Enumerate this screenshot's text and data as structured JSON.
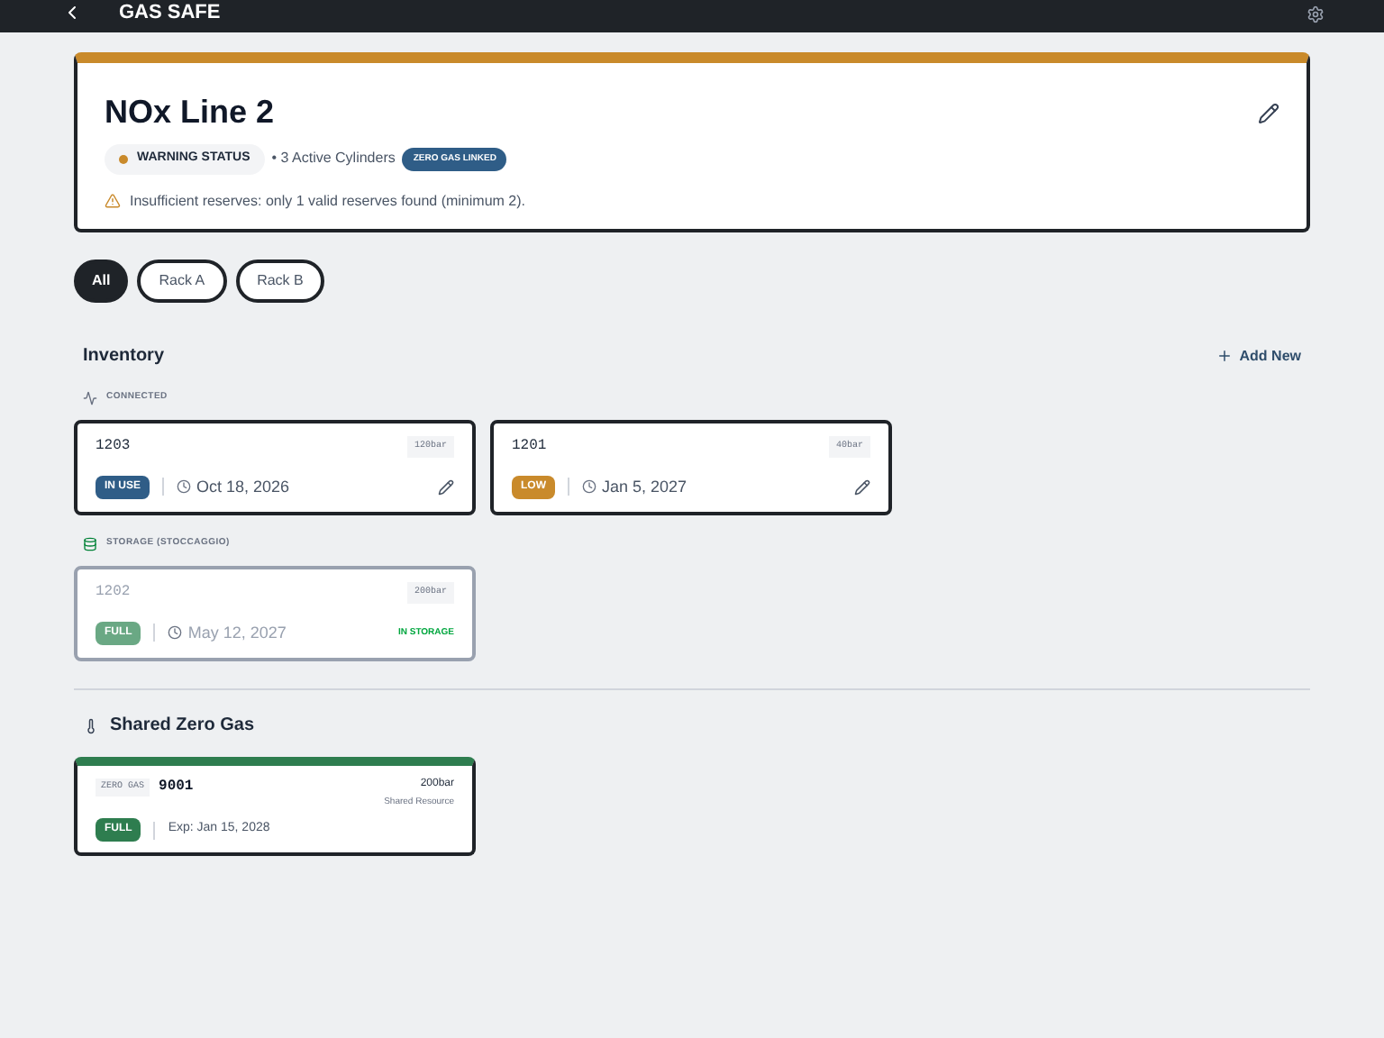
{
  "app_bar": {
    "title": "GAS SAFE"
  },
  "line": {
    "name": "NOx Line 2",
    "status": "WARNING STATUS",
    "color": "#c98a2b",
    "cylinders": "• 3 Active Cylinders",
    "linked_badge": "ZERO GAS LINKED",
    "warning": "Insufficient reserves: only 1 valid reserves found (minimum 2)."
  },
  "filters": [
    {
      "label": "All",
      "selected": true
    },
    {
      "label": "Rack A",
      "selected": false
    },
    {
      "label": "Rack B",
      "selected": false
    }
  ],
  "inventory": {
    "title": "Inventory",
    "add_button": "Add New",
    "groups": [
      {
        "kind": "connected",
        "title": "CONNECTED",
        "cylinders": [
          {
            "id": "1203",
            "pressure": "120bar",
            "status": "IN USE",
            "color": "#2f5d87",
            "date": "Oct 18, 2026",
            "dimmed": false
          },
          {
            "id": "1201",
            "pressure": "40bar",
            "status": "LOW",
            "color": "#c98a2b",
            "date": "Jan 5, 2027",
            "dimmed": false
          }
        ]
      },
      {
        "kind": "storage",
        "title": "STORAGE (STOCCAGGIO)",
        "cylinders": [
          {
            "id": "1202",
            "pressure": "200bar",
            "status": "FULL",
            "color": "#6aa884",
            "date": "May 12, 2027",
            "dimmed": true,
            "note": "IN STORAGE"
          }
        ]
      }
    ]
  },
  "shared": {
    "title": "Shared Zero Gas",
    "cylinder": {
      "tag": "ZERO GAS",
      "id": "9001",
      "status": "FULL",
      "color": "#2e7d4f",
      "expiry": "Exp: Jan 15, 2028",
      "pressure": "200bar",
      "note": "Shared Resource"
    }
  }
}
